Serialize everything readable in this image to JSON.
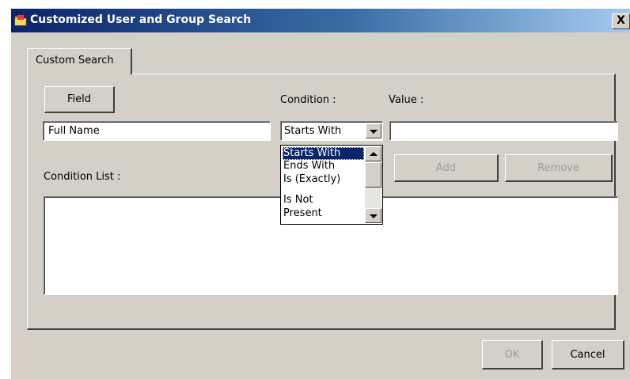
{
  "window": {
    "title": "Customized User and Group Search",
    "close_glyph": "X",
    "title_icon": "folder-icon"
  },
  "tabs": [
    {
      "label": "Custom Search"
    }
  ],
  "form": {
    "field_button_label": "Field",
    "condition_label": "Condition :",
    "value_label": "Value :",
    "field_value": "Full Name",
    "condition_selected": "Starts With",
    "value_input": "",
    "condition_options": [
      "Starts With",
      "Ends With",
      "Is (Exactly)",
      "Is Not",
      "Present"
    ],
    "condition_list_label": "Condition List :",
    "add_label": "Add",
    "remove_label": "Remove"
  },
  "footer": {
    "ok_label": "OK",
    "cancel_label": "Cancel"
  },
  "colors": {
    "title_bar": "#0a246a",
    "dialog_bg": "#d4d0c8",
    "selection": "#0a246a"
  }
}
